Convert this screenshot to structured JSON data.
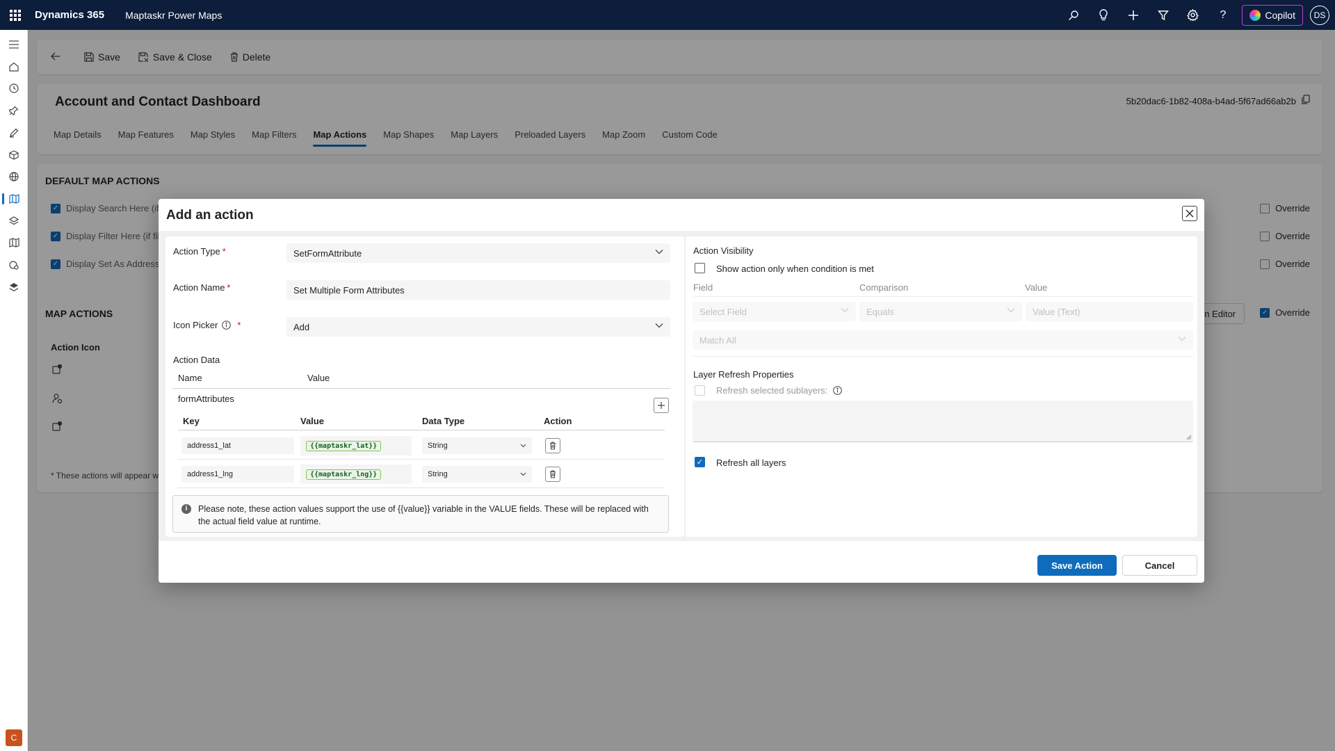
{
  "topbar": {
    "brand": "Dynamics 365",
    "app_name": "Maptaskr Power Maps",
    "copilot_label": "Copilot",
    "avatar_initials": "DS",
    "icons": [
      "search-icon",
      "lightbulb-icon",
      "plus-icon",
      "filter-icon",
      "gear-icon",
      "help-icon"
    ]
  },
  "leftnav": {
    "icons": [
      "hamburger-icon",
      "home-icon",
      "recent-icon",
      "pin-icon",
      "pen-icon",
      "box-icon",
      "globe-icon",
      "map-icon",
      "layers-icon",
      "map-outline-icon",
      "settings-map-icon",
      "stack-icon"
    ],
    "area_letter": "C"
  },
  "command_bar": {
    "save": "Save",
    "save_close": "Save & Close",
    "delete": "Delete"
  },
  "form": {
    "title": "Account and Contact Dashboard",
    "record_id": "5b20dac6-1b82-408a-b4ad-5f67ad66ab2b",
    "tabs": [
      "Map Details",
      "Map Features",
      "Map Styles",
      "Map Filters",
      "Map Actions",
      "Map Shapes",
      "Map Layers",
      "Preloaded Layers",
      "Map Zoom",
      "Custom Code"
    ],
    "active_tab": "Map Actions"
  },
  "background": {
    "default_section_title": "DEFAULT MAP ACTIONS",
    "default_rows": [
      "Display Search Here (if",
      "Display Filter Here (if fil",
      "Display Set As Address"
    ],
    "override_label": "Override",
    "map_actions_title": "MAP ACTIONS",
    "action_icon_col": "Action Icon",
    "editor_button": "ion Editor",
    "footnote": "* These actions will appear wi"
  },
  "dialog": {
    "title": "Add an action",
    "action_type_label": "Action Type",
    "action_type_value": "SetFormAttribute",
    "action_name_label": "Action Name",
    "action_name_value": "Set Multiple Form Attributes",
    "icon_picker_label": "Icon Picker",
    "icon_picker_value": "Add",
    "required_mark": "*",
    "action_data_label": "Action Data",
    "name_col": "Name",
    "value_col": "Value",
    "attr_name": "formAttributes",
    "sub_headers": {
      "key": "Key",
      "value": "Value",
      "data_type": "Data Type",
      "action": "Action"
    },
    "rows": [
      {
        "key": "address1_lat",
        "value": "{{maptaskr_lat}}",
        "data_type": "String"
      },
      {
        "key": "address1_lng",
        "value": "{{maptaskr_lng}}",
        "data_type": "String"
      }
    ],
    "note": "Please note, these action values support the use of {{value}} variable in the VALUE fields. These will be replaced with the actual field value at runtime.",
    "visibility_title": "Action Visibility",
    "show_condition_label": "Show action only when condition is met",
    "field_col": "Field",
    "comparison_col": "Comparison",
    "value_col2": "Value",
    "select_field_placeholder": "Select Field",
    "equals_placeholder": "Equals",
    "value_text_placeholder": "Value (Text)",
    "match_all": "Match All",
    "layer_refresh_title": "Layer Refresh Properties",
    "refresh_sublayers_label": "Refresh selected sublayers:",
    "refresh_all_label": "Refresh all layers",
    "save_action": "Save Action",
    "cancel": "Cancel"
  }
}
